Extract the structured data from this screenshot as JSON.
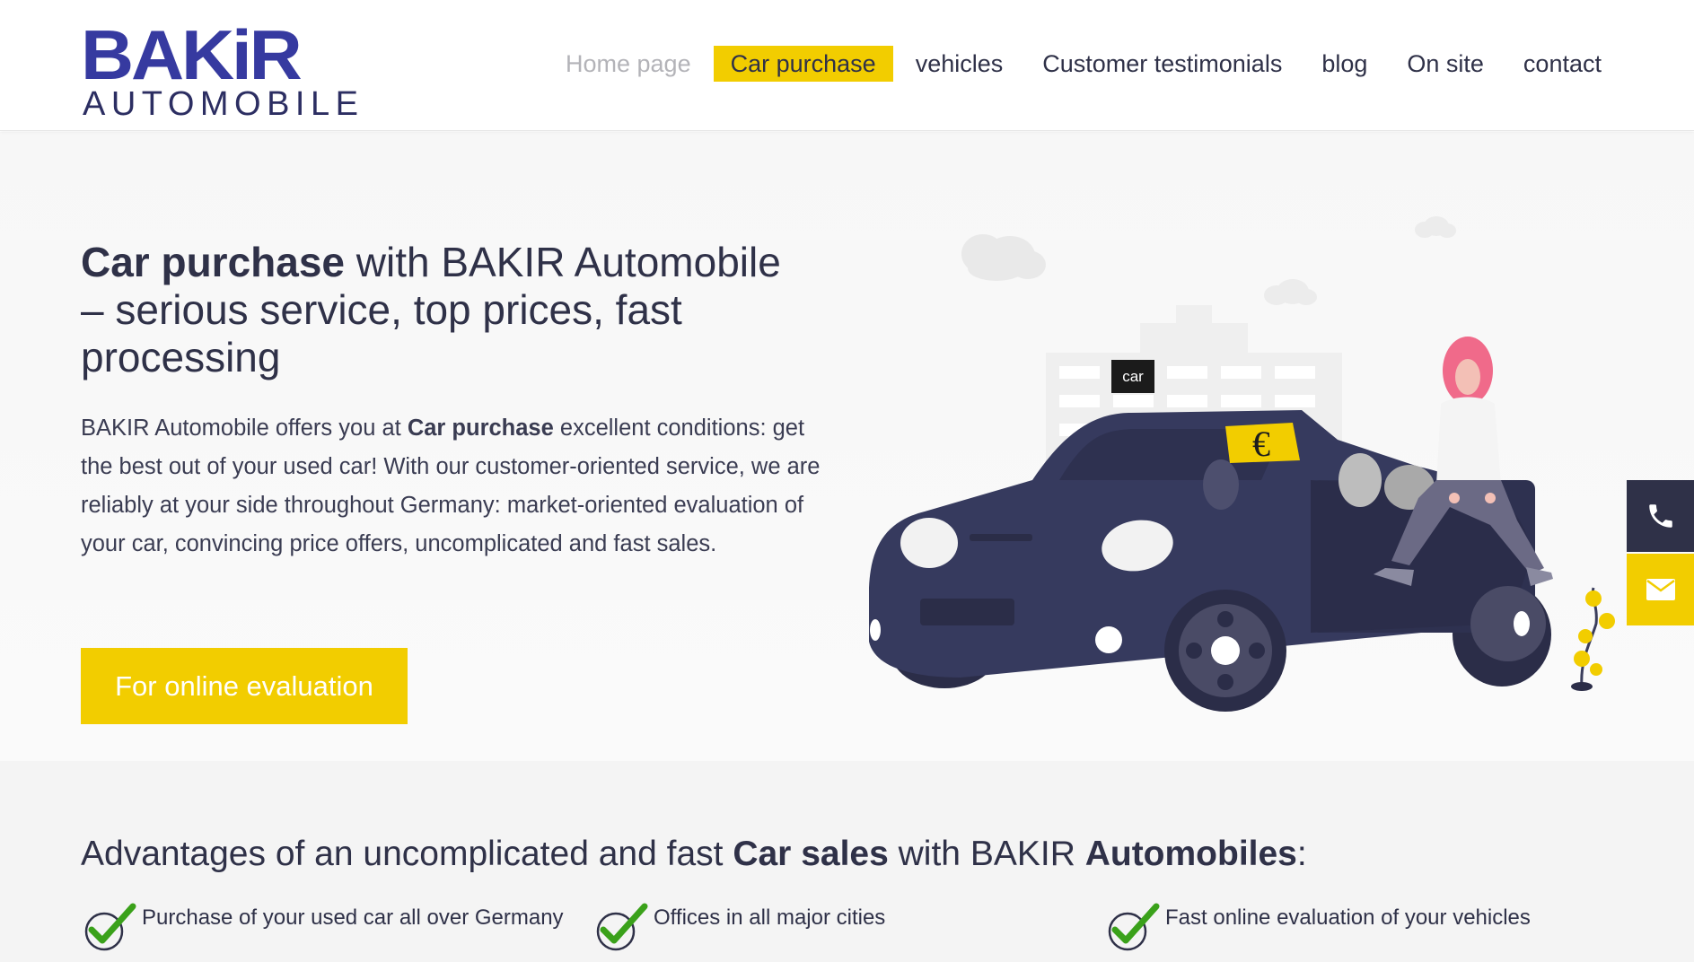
{
  "brand": {
    "logo_top": "BAKiR",
    "logo_bottom": "AUTOMOBILE",
    "primary_color": "#363aa0",
    "accent_color": "#f2cd00",
    "dark_color": "#2f3148"
  },
  "nav": {
    "items": [
      {
        "label": "Home page"
      },
      {
        "label": "Car purchase"
      },
      {
        "label": "vehicles"
      },
      {
        "label": "Customer testimonials"
      },
      {
        "label": "blog"
      },
      {
        "label": "On site"
      },
      {
        "label": "contact"
      }
    ]
  },
  "hero": {
    "title_bold": "Car purchase",
    "title_rest_1": " with BAKIR Automobile",
    "title_rest_2": "– serious service, top prices, fast processing",
    "text_1": "BAKIR Automobile offers you at ",
    "text_bold": "Car purchase",
    "text_2": " excellent conditions: get the best out of your used car! With our customer-oriented service, we are reliably at your side throughout Germany: market-oriented evaluation of your car, convincing price offers, uncomplicated and fast sales.",
    "cta": "For online evaluation",
    "tooltip": "car",
    "price_sign": "€"
  },
  "side": {
    "phone_icon": "phone-icon",
    "mail_icon": "envelope-icon"
  },
  "advantages": {
    "title_1": "Advantages of an uncomplicated and fast ",
    "title_bold_1": "Car sales",
    "title_2": " with BAKIR ",
    "title_bold_2": "Automobiles",
    "title_3": ":",
    "items": [
      {
        "label": "Purchase of your used car all over Germany"
      },
      {
        "label": "Offices in all major cities"
      },
      {
        "label": "Fast online evaluation of your vehicles"
      }
    ]
  }
}
